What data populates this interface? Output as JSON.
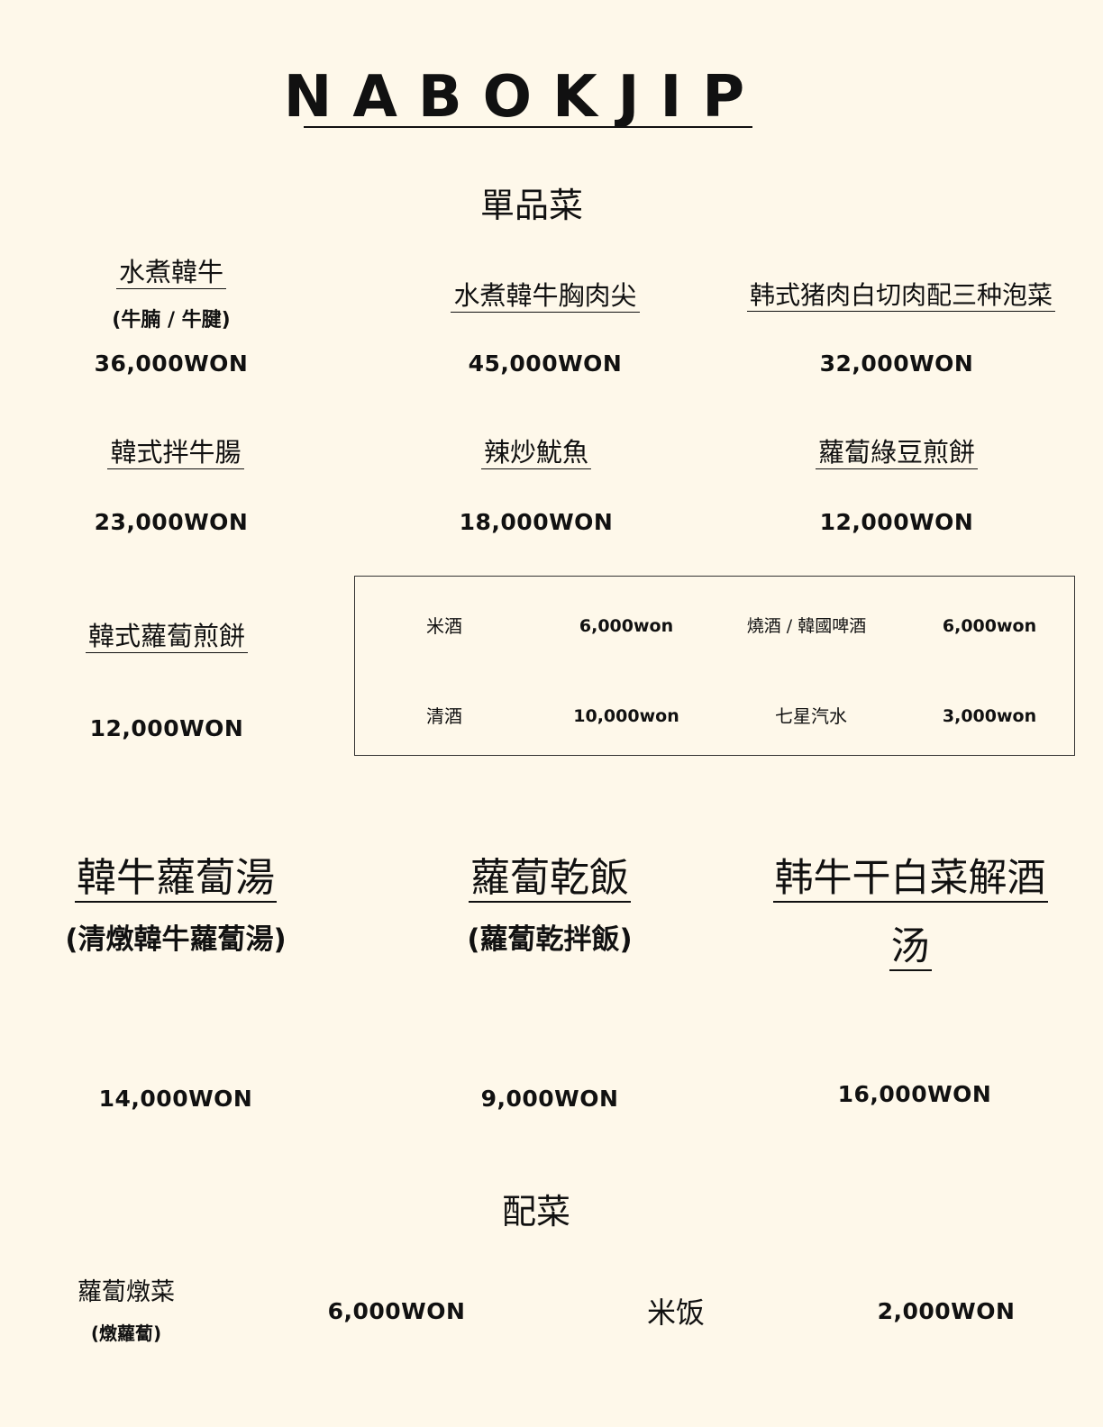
{
  "title": "NABOKJIP",
  "sections": {
    "singles": "單品菜",
    "sides": "配菜"
  },
  "singles": [
    {
      "name": "水煮韓牛",
      "sub": "(牛腩 / 牛腱)",
      "price": "36,000WON"
    },
    {
      "name": "水煮韓牛胸肉尖",
      "price": "45,000WON"
    },
    {
      "name": "韩式猪肉白切肉配三种泡菜",
      "price": "32,000WON"
    },
    {
      "name": "韓式拌牛腸",
      "price": "23,000WON"
    },
    {
      "name": "辣炒魷魚",
      "price": "18,000WON"
    },
    {
      "name": "蘿蔔綠豆煎餅",
      "price": "12,000WON"
    },
    {
      "name": "韓式蘿蔔煎餅",
      "price": "12,000WON"
    }
  ],
  "drinks": [
    {
      "name": "米酒",
      "price": "6,000won"
    },
    {
      "name": "燒酒 / 韓國啤酒",
      "price": "6,000won"
    },
    {
      "name": "清酒",
      "price": "10,000won"
    },
    {
      "name": "七星汽水",
      "price": "3,000won"
    }
  ],
  "soups": [
    {
      "name": "韓牛蘿蔔湯",
      "sub": "(清燉韓牛蘿蔔湯)",
      "price": "14,000WON"
    },
    {
      "name": "蘿蔔乾飯",
      "sub": "(蘿蔔乾拌飯)",
      "price": "9,000WON"
    },
    {
      "name_line1": "韩牛干白菜解酒",
      "name_line2": "汤",
      "price": "16,000WON"
    }
  ],
  "sides": [
    {
      "name": "蘿蔔燉菜",
      "sub": "(燉蘿蔔)",
      "price": "6,000WON"
    },
    {
      "name": "米饭",
      "price": "2,000WON"
    }
  ]
}
